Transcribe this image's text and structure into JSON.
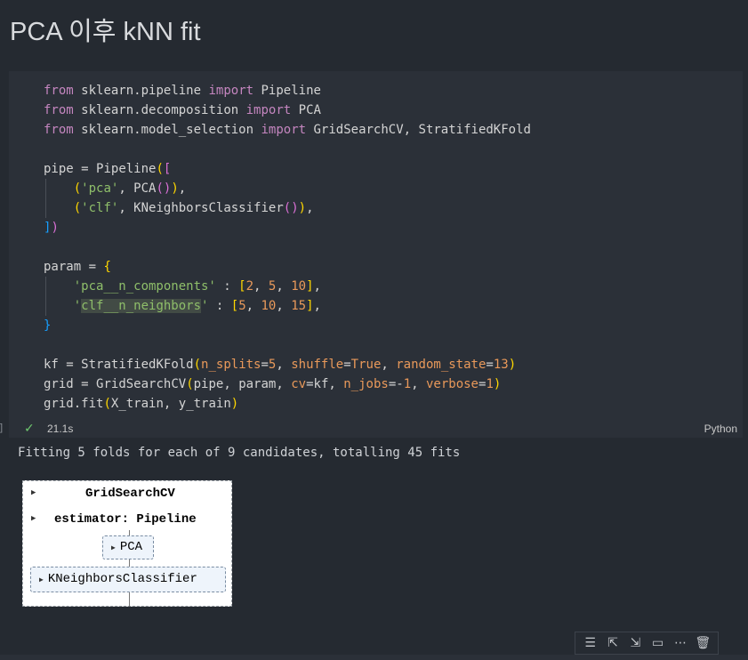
{
  "markdown": {
    "title": "PCA 이후 kNN fit"
  },
  "cell": {
    "status": {
      "bracket": "]",
      "duration": "21.1s",
      "language": "Python"
    },
    "output_text": "Fitting 5 folds for each of 9 candidates, totalling 45 fits"
  },
  "diagram": {
    "root": "GridSearchCV",
    "estimator": "estimator: Pipeline",
    "step1": "PCA",
    "step2": "KNeighborsClassifier"
  },
  "toolbar": {
    "icons": [
      "run-by-line-icon",
      "execute-above-icon",
      "execute-below-icon",
      "split-cell-icon",
      "more-icon",
      "delete-icon"
    ]
  },
  "code_lines": [
    "from sklearn.pipeline import Pipeline",
    "from sklearn.decomposition import PCA",
    "from sklearn.model_selection import GridSearchCV, StratifiedKFold",
    "",
    "pipe = Pipeline([",
    "    ('pca', PCA()),",
    "    ('clf', KNeighborsClassifier()),",
    "])",
    "",
    "param = {",
    "    'pca__n_components' : [2, 5, 10],",
    "    'clf__n_neighbors' : [5, 10, 15],",
    "}",
    "",
    "kf = StratifiedKFold(n_splits=5, shuffle=True, random_state=13)",
    "grid = GridSearchCV(pipe, param, cv=kf, n_jobs=-1, verbose=1)",
    "grid.fit(X_train, y_train)"
  ]
}
